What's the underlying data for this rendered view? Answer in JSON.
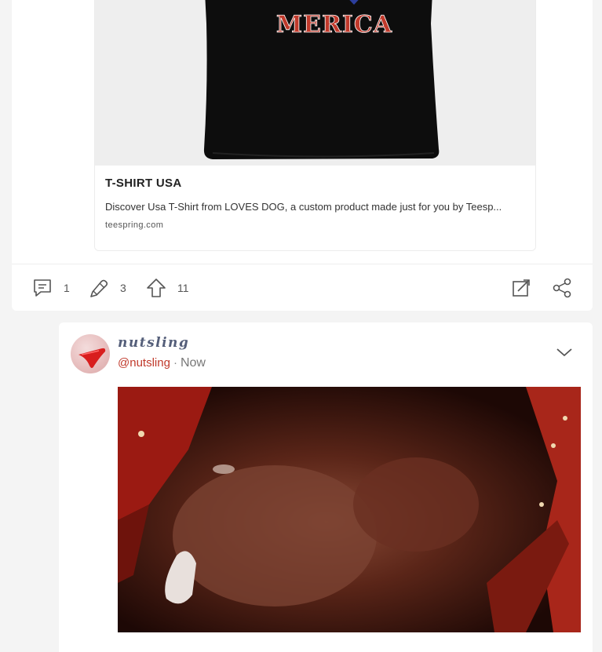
{
  "link_card": {
    "shirt_text": "MERICA",
    "title": "T-SHIRT USA",
    "description": "Discover Usa T-Shirt from LOVES DOG, a custom product made just for you by Teesp...",
    "domain": "teespring.com"
  },
  "actions": {
    "comments": {
      "icon": "comment-icon",
      "count": "1"
    },
    "recasts": {
      "icon": "recast-icon",
      "count": "3"
    },
    "upvotes": {
      "icon": "upvote-icon",
      "count": "11"
    },
    "expand_icon": "expand-icon",
    "share_icon": "share-icon"
  },
  "post": {
    "display_name": "nutsling",
    "handle": "@nutsling",
    "separator": "·",
    "time": "Now",
    "menu_icon": "chevron-down-icon"
  },
  "colors": {
    "handle": "#c0392b",
    "icon_stroke": "#555555",
    "background": "#f4f4f4"
  }
}
